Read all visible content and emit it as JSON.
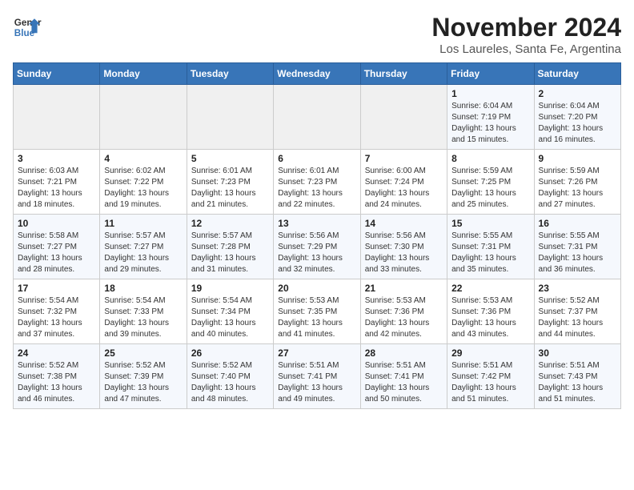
{
  "header": {
    "logo_line1": "General",
    "logo_line2": "Blue",
    "month": "November 2024",
    "location": "Los Laureles, Santa Fe, Argentina"
  },
  "weekdays": [
    "Sunday",
    "Monday",
    "Tuesday",
    "Wednesday",
    "Thursday",
    "Friday",
    "Saturday"
  ],
  "weeks": [
    [
      {
        "day": "",
        "info": ""
      },
      {
        "day": "",
        "info": ""
      },
      {
        "day": "",
        "info": ""
      },
      {
        "day": "",
        "info": ""
      },
      {
        "day": "",
        "info": ""
      },
      {
        "day": "1",
        "info": "Sunrise: 6:04 AM\nSunset: 7:19 PM\nDaylight: 13 hours and 15 minutes."
      },
      {
        "day": "2",
        "info": "Sunrise: 6:04 AM\nSunset: 7:20 PM\nDaylight: 13 hours and 16 minutes."
      }
    ],
    [
      {
        "day": "3",
        "info": "Sunrise: 6:03 AM\nSunset: 7:21 PM\nDaylight: 13 hours and 18 minutes."
      },
      {
        "day": "4",
        "info": "Sunrise: 6:02 AM\nSunset: 7:22 PM\nDaylight: 13 hours and 19 minutes."
      },
      {
        "day": "5",
        "info": "Sunrise: 6:01 AM\nSunset: 7:23 PM\nDaylight: 13 hours and 21 minutes."
      },
      {
        "day": "6",
        "info": "Sunrise: 6:01 AM\nSunset: 7:23 PM\nDaylight: 13 hours and 22 minutes."
      },
      {
        "day": "7",
        "info": "Sunrise: 6:00 AM\nSunset: 7:24 PM\nDaylight: 13 hours and 24 minutes."
      },
      {
        "day": "8",
        "info": "Sunrise: 5:59 AM\nSunset: 7:25 PM\nDaylight: 13 hours and 25 minutes."
      },
      {
        "day": "9",
        "info": "Sunrise: 5:59 AM\nSunset: 7:26 PM\nDaylight: 13 hours and 27 minutes."
      }
    ],
    [
      {
        "day": "10",
        "info": "Sunrise: 5:58 AM\nSunset: 7:27 PM\nDaylight: 13 hours and 28 minutes."
      },
      {
        "day": "11",
        "info": "Sunrise: 5:57 AM\nSunset: 7:27 PM\nDaylight: 13 hours and 29 minutes."
      },
      {
        "day": "12",
        "info": "Sunrise: 5:57 AM\nSunset: 7:28 PM\nDaylight: 13 hours and 31 minutes."
      },
      {
        "day": "13",
        "info": "Sunrise: 5:56 AM\nSunset: 7:29 PM\nDaylight: 13 hours and 32 minutes."
      },
      {
        "day": "14",
        "info": "Sunrise: 5:56 AM\nSunset: 7:30 PM\nDaylight: 13 hours and 33 minutes."
      },
      {
        "day": "15",
        "info": "Sunrise: 5:55 AM\nSunset: 7:31 PM\nDaylight: 13 hours and 35 minutes."
      },
      {
        "day": "16",
        "info": "Sunrise: 5:55 AM\nSunset: 7:31 PM\nDaylight: 13 hours and 36 minutes."
      }
    ],
    [
      {
        "day": "17",
        "info": "Sunrise: 5:54 AM\nSunset: 7:32 PM\nDaylight: 13 hours and 37 minutes."
      },
      {
        "day": "18",
        "info": "Sunrise: 5:54 AM\nSunset: 7:33 PM\nDaylight: 13 hours and 39 minutes."
      },
      {
        "day": "19",
        "info": "Sunrise: 5:54 AM\nSunset: 7:34 PM\nDaylight: 13 hours and 40 minutes."
      },
      {
        "day": "20",
        "info": "Sunrise: 5:53 AM\nSunset: 7:35 PM\nDaylight: 13 hours and 41 minutes."
      },
      {
        "day": "21",
        "info": "Sunrise: 5:53 AM\nSunset: 7:36 PM\nDaylight: 13 hours and 42 minutes."
      },
      {
        "day": "22",
        "info": "Sunrise: 5:53 AM\nSunset: 7:36 PM\nDaylight: 13 hours and 43 minutes."
      },
      {
        "day": "23",
        "info": "Sunrise: 5:52 AM\nSunset: 7:37 PM\nDaylight: 13 hours and 44 minutes."
      }
    ],
    [
      {
        "day": "24",
        "info": "Sunrise: 5:52 AM\nSunset: 7:38 PM\nDaylight: 13 hours and 46 minutes."
      },
      {
        "day": "25",
        "info": "Sunrise: 5:52 AM\nSunset: 7:39 PM\nDaylight: 13 hours and 47 minutes."
      },
      {
        "day": "26",
        "info": "Sunrise: 5:52 AM\nSunset: 7:40 PM\nDaylight: 13 hours and 48 minutes."
      },
      {
        "day": "27",
        "info": "Sunrise: 5:51 AM\nSunset: 7:41 PM\nDaylight: 13 hours and 49 minutes."
      },
      {
        "day": "28",
        "info": "Sunrise: 5:51 AM\nSunset: 7:41 PM\nDaylight: 13 hours and 50 minutes."
      },
      {
        "day": "29",
        "info": "Sunrise: 5:51 AM\nSunset: 7:42 PM\nDaylight: 13 hours and 51 minutes."
      },
      {
        "day": "30",
        "info": "Sunrise: 5:51 AM\nSunset: 7:43 PM\nDaylight: 13 hours and 51 minutes."
      }
    ]
  ]
}
